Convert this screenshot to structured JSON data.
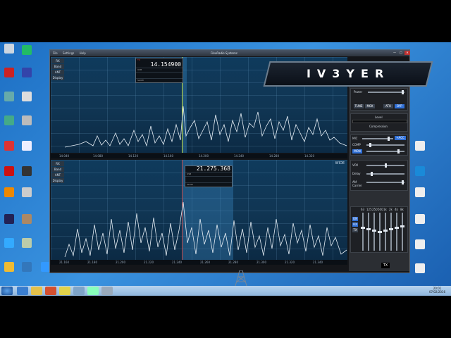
{
  "app": {
    "title": "FlexRadio Systems",
    "menu": [
      "File",
      "Settings",
      "Help"
    ],
    "window_buttons": [
      "—",
      "□",
      "✕"
    ]
  },
  "callsign": "IV3YER",
  "panadapter_top": {
    "side_buttons": [
      "RX",
      "Band",
      "ANT",
      "Display"
    ],
    "slice": {
      "badge": "TX",
      "frequency": "14.154900",
      "mode": "USB",
      "agc": "SLOW"
    },
    "scale": [
      "14.040",
      "14.080",
      "14.120",
      "14.160",
      "14.200",
      "14.240",
      "14.280",
      "14.320"
    ]
  },
  "panadapter_bottom": {
    "side_buttons": [
      "RX",
      "Band",
      "ANT",
      "Display"
    ],
    "slice": {
      "frequency": "21.275.368",
      "mode": "USB",
      "agc": "SLOW"
    },
    "corner_label": "WIDE",
    "scale": [
      "21.160",
      "21.180",
      "21.200",
      "21.220",
      "21.240",
      "21.260",
      "21.280",
      "21.300",
      "21.320",
      "21.340"
    ]
  },
  "right_panel": {
    "power_label": "Power",
    "tune": "TUNE",
    "mox": "MOX",
    "atu": "ATU",
    "byp": "BYP",
    "level": "Level",
    "compression": "Compression",
    "mic": "MIC",
    "acc": "+ACC",
    "comp": "COMP",
    "mon": "MON",
    "vox": "VOX",
    "delay": "Delay",
    "am_carrier": "AM Carrier",
    "eq_labels": [
      "63",
      "125",
      "250",
      "500",
      "1k",
      "2k",
      "4k",
      "8k"
    ],
    "eq_on": "ON",
    "eq_rx": "RX",
    "eq_tx": "TX",
    "tx_indicator": "TX"
  },
  "taskbar": {
    "time": "20:01",
    "date": "07/02/2016"
  },
  "colors": {
    "spectrum": "#e6eef5",
    "slice_line": "#c8e040",
    "accent": "#2f6fd6"
  }
}
